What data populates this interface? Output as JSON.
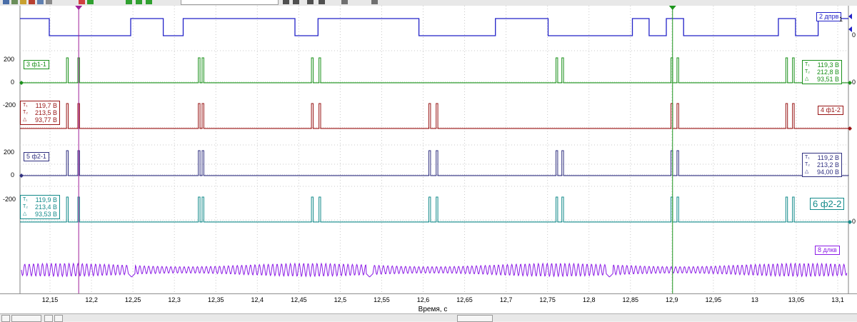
{
  "channels": {
    "ch2": {
      "name": "2 дпрв",
      "color": "#2222c8",
      "scale_hi": "1",
      "scale_lo": "0"
    },
    "ch3": {
      "name": "3 ф1-1",
      "color": "#199019",
      "scale_hi": "200",
      "scale_zero": "0",
      "m1": "119,3 В",
      "m2": "212,8 В",
      "delta": "93,51 В",
      "offset": "0"
    },
    "ch4": {
      "name": "4 ф1-2",
      "color": "#981414",
      "scale": "-200",
      "m1": "119,7 В",
      "m2": "213,5 В",
      "delta": "93,77 В"
    },
    "ch5": {
      "name": "5 ф2-1",
      "color": "#303080",
      "scale_hi": "200",
      "scale_zero": "0",
      "m1": "119,2 В",
      "m2": "213,2 В",
      "delta": "94,00 В"
    },
    "ch6": {
      "name": "6 ф2-2",
      "color": "#128a8a",
      "scale": "-200",
      "m1": "119,9 В",
      "m2": "213,4 В",
      "delta": "93,53 В",
      "offset": "0"
    },
    "ch8": {
      "name": "8 длкв",
      "color": "#8c1ce6"
    }
  },
  "xaxis": {
    "title": "Время, с",
    "ticks": [
      {
        "v": 12.15,
        "label": "12,15"
      },
      {
        "v": 12.2,
        "label": "12,2"
      },
      {
        "v": 12.25,
        "label": "12,25"
      },
      {
        "v": 12.3,
        "label": "12,3"
      },
      {
        "v": 12.35,
        "label": "12,35"
      },
      {
        "v": 12.4,
        "label": "12,4"
      },
      {
        "v": 12.45,
        "label": "12,45"
      },
      {
        "v": 12.5,
        "label": "12,5"
      },
      {
        "v": 12.55,
        "label": "12,55"
      },
      {
        "v": 12.6,
        "label": "12,6"
      },
      {
        "v": 12.65,
        "label": "12,65"
      },
      {
        "v": 12.7,
        "label": "12,7"
      },
      {
        "v": 12.75,
        "label": "12,75"
      },
      {
        "v": 12.8,
        "label": "12,8"
      },
      {
        "v": 12.85,
        "label": "12,85"
      },
      {
        "v": 12.9,
        "label": "12,9"
      },
      {
        "v": 12.95,
        "label": "12,95"
      },
      {
        "v": 13,
        "label": "13"
      },
      {
        "v": 13.05,
        "label": "13,05"
      },
      {
        "v": 13.1,
        "label": "13,1"
      }
    ],
    "range": [
      12.1138,
      13.1129
    ]
  },
  "cursors": [
    {
      "name": "cursor-1",
      "t": 12.1846,
      "color": "#a0209a"
    },
    {
      "name": "cursor-2",
      "t": 12.9008,
      "color": "#1e961e"
    }
  ],
  "trace_data": {
    "ch2_edges": [
      12.1491,
      12.2473,
      12.2866,
      12.3106,
      12.4454,
      12.4732,
      12.5949,
      12.6872,
      12.7507,
      12.8524,
      12.8725,
      12.8933,
      12.9141,
      13.0284,
      13.0491,
      13.0764
    ],
    "pulse_bursts": {
      "ch3": [
        12.1709,
        12.1846,
        12.3299,
        12.3345,
        12.4663,
        12.4754,
        12.7612,
        12.7683,
        12.8999,
        12.9071,
        13.0384,
        13.0465
      ],
      "ch4": [
        12.1709,
        12.1846,
        12.3299,
        12.3345,
        12.4663,
        12.4754,
        12.6079,
        12.6167,
        12.8999,
        12.9071,
        13.0384,
        13.0465
      ],
      "ch5": [
        12.1709,
        12.1846,
        12.3299,
        12.3345,
        12.6079,
        12.6167,
        12.7612,
        12.7683,
        12.8999,
        12.9071
      ],
      "ch6": [
        12.1709,
        12.1846,
        12.3299,
        12.3345,
        12.4663,
        12.4754,
        12.6079,
        12.6167,
        12.7612,
        12.7683,
        12.8999,
        12.9071,
        13.0384,
        13.0465
      ]
    },
    "ch8_gaps": [
      12.2484,
      12.5354,
      12.8247
    ]
  }
}
